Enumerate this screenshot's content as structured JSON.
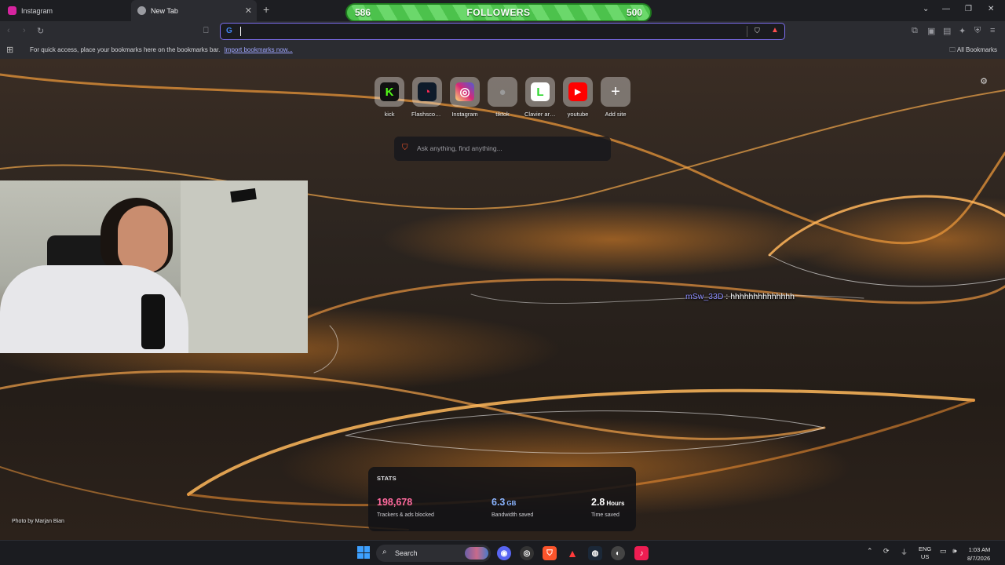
{
  "tabs": [
    {
      "title": "Instagram",
      "favicon_color": "#d6249f"
    },
    {
      "title": "New Tab",
      "favicon_color": "#9a9ba1"
    }
  ],
  "followers_bar": {
    "current": "586",
    "label": "FOLLOWERS",
    "goal": "500"
  },
  "address_bar": {
    "value": "",
    "engine_icon": "G"
  },
  "bookmarks_bar": {
    "message": "For quick access, place your bookmarks here on the bookmarks bar.",
    "import_link": "Import bookmarks now...",
    "all_bookmarks": "All Bookmarks"
  },
  "top_sites": [
    {
      "label": "kick",
      "icon": "kick-icon",
      "glyph": "K",
      "color": "#53fc18",
      "bg": "#111111"
    },
    {
      "label": "Flashscore....",
      "icon": "flashscore-icon",
      "glyph": "◔",
      "color": "#ff2a55",
      "bg": "#0e1b2a"
    },
    {
      "label": "Instagram",
      "icon": "instagram-icon",
      "glyph": "◎",
      "color": "#ffffff",
      "bg": "#c13584"
    },
    {
      "label": "tiktok",
      "icon": "globe-icon",
      "glyph": "●",
      "color": "#9a9a9a",
      "bg": "transparent"
    },
    {
      "label": "Clavier ara...",
      "icon": "clavier-icon",
      "glyph": "L",
      "color": "#2bd62b",
      "bg": "#ffffff"
    },
    {
      "label": "youtube",
      "icon": "youtube-icon",
      "glyph": "▶",
      "color": "#ffffff",
      "bg": "#ff0000"
    },
    {
      "label": "Add site",
      "icon": "plus-icon",
      "glyph": "+",
      "color": "#ffffff",
      "bg": "transparent"
    }
  ],
  "search": {
    "placeholder": "Ask anything, find anything..."
  },
  "chat": {
    "username": "mSw_33D",
    "separator": " : ",
    "message": "hhhhhhhhhhhhhh"
  },
  "stats": {
    "heading": "STATS",
    "items": [
      {
        "value": "198,678",
        "unit": "",
        "label": "Trackers & ads blocked"
      },
      {
        "value": "6.3",
        "unit": "GB",
        "label": "Bandwidth saved"
      },
      {
        "value": "2.8",
        "unit": "Hours",
        "label": "Time saved"
      }
    ]
  },
  "photo_credit": "Photo by Marjan Bian",
  "taskbar": {
    "search_label": "Search",
    "lang_line1": "ENG",
    "lang_line2": "US",
    "time": "1:03 AM",
    "date": "8/7/2026"
  }
}
